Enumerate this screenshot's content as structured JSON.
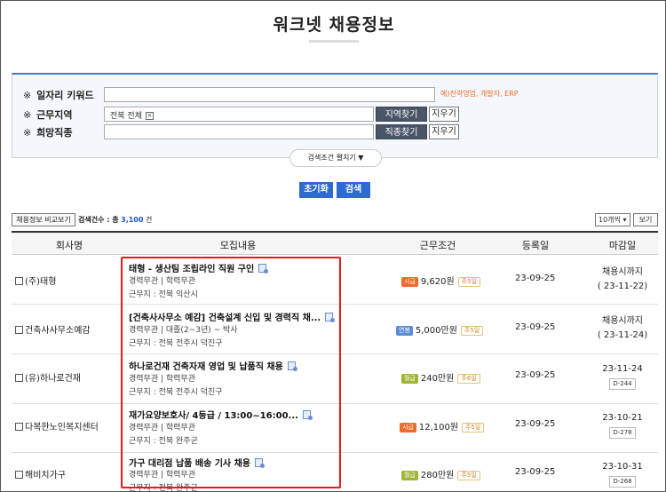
{
  "page": {
    "title": "워크넷 채용정보"
  },
  "search": {
    "keyword_label": "일자리 키워드",
    "keyword_value": "",
    "keyword_hint": "예)전략영업, 개발자, ERP",
    "region_label": "근무지역",
    "region_value": "전북 전체",
    "region_find": "지역찾기",
    "region_clear": "지우기",
    "job_label": "희망직종",
    "job_value": "",
    "job_find": "직종찾기",
    "job_clear": "지우기",
    "expand_label": "검색조건 펼치기 ▼",
    "mark": "※"
  },
  "actions": {
    "reset": "초기화",
    "search": "검색"
  },
  "results": {
    "compare_label": "채용정보 비교보기",
    "count_prefix": "검색건수 : 총",
    "count": "3,100",
    "count_suffix": "건",
    "per_page": "10개씩",
    "view_label": "보기"
  },
  "table": {
    "headers": [
      "회사명",
      "모집내용",
      "근무조건",
      "등록일",
      "마감일"
    ],
    "rows": [
      {
        "company": "(주)태형",
        "title": "태형 - 생산팀 조립라인 직원 구인",
        "line1": "경력무관 | 학력무관",
        "line2": "근무지 : 전북 익산시",
        "pay_type": "시급",
        "pay": "9,620원",
        "week": "주5일",
        "reg": "23-09-25",
        "due1": "채용시까지",
        "due2": "( 23-11-22)",
        "dday": ""
      },
      {
        "company": "건축사사무소예감",
        "title": "[건축사사무소 예감] 건축설계 신입 및 경력직 채...",
        "line1": "경력무관 | 대졸(2~3년) ~ 박사",
        "line2": "근무지 : 전북 전주시 덕진구",
        "pay_type": "연봉",
        "pay": "5,000만원",
        "week": "주5일",
        "reg": "23-09-25",
        "due1": "채용시까지",
        "due2": "( 23-11-24)",
        "dday": ""
      },
      {
        "company": "(유)하나로건재",
        "title": "하나로건재 건축자재 영업 및 납품직 채용",
        "line1": "경력무관 | 학력무관",
        "line2": "근무지 : 전북 전주시 덕진구",
        "pay_type": "월급",
        "pay": "240만원",
        "week": "주6일",
        "reg": "23-09-25",
        "due1": "23-11-24",
        "due2": "",
        "dday": "D-244"
      },
      {
        "company": "다복한노인복지센터",
        "title": "재가요양보호사/ 4등급 / 13:00~16:00...",
        "line1": "경력무관 | 학력무관",
        "line2": "근무지 : 전북 완주군",
        "pay_type": "시급",
        "pay": "12,100원",
        "week": "주5일",
        "reg": "23-09-25",
        "due1": "23-10-21",
        "due2": "",
        "dday": "D-278"
      },
      {
        "company": "해비치가구",
        "title": "가구 대리점 납품 배송 기사 채용",
        "line1": "경력무관 | 학력무관",
        "line2": "근무지 : 전북 완주군",
        "pay_type": "월급",
        "pay": "280만원",
        "week": "주5일",
        "reg": "23-09-25",
        "due1": "23-10-31",
        "due2": "",
        "dday": "D-268"
      }
    ]
  },
  "colors": {
    "accent_blue": "#2d6ad1",
    "hourly_badge": "#f06a28",
    "salary_badge": "#5b8ed8",
    "monthly_badge": "#9fb536",
    "highlight": "#e8181b"
  }
}
